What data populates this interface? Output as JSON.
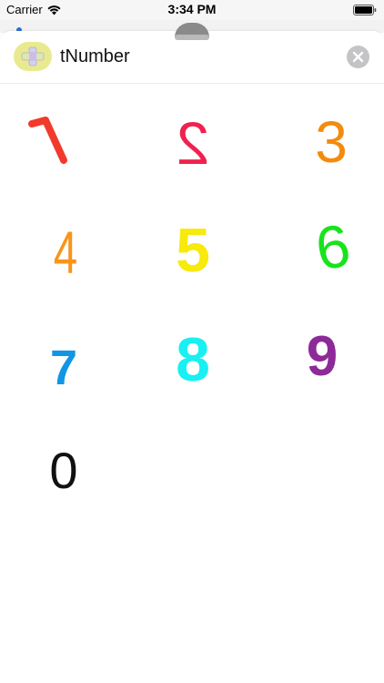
{
  "status_bar": {
    "carrier": "Carrier",
    "time": "3:34 PM",
    "wifi_icon": "wifi-icon",
    "battery_icon": "battery-icon"
  },
  "header": {
    "title": "tNumber",
    "app_icon": "plus-app-icon",
    "close_icon": "close-icon"
  },
  "stickers": [
    {
      "label": "1",
      "color": "#f23a2c"
    },
    {
      "label": "2",
      "color": "#f0214f"
    },
    {
      "label": "3",
      "color": "#f48a0e"
    },
    {
      "label": "4",
      "color": "#f7951a"
    },
    {
      "label": "5",
      "color": "#f7ea0c"
    },
    {
      "label": "6",
      "color": "#19e31c"
    },
    {
      "label": "7",
      "color": "#1196e6"
    },
    {
      "label": "8",
      "color": "#18f0f2"
    },
    {
      "label": "9",
      "color": "#8e2a98"
    },
    {
      "label": "0",
      "color": "#111111"
    }
  ]
}
